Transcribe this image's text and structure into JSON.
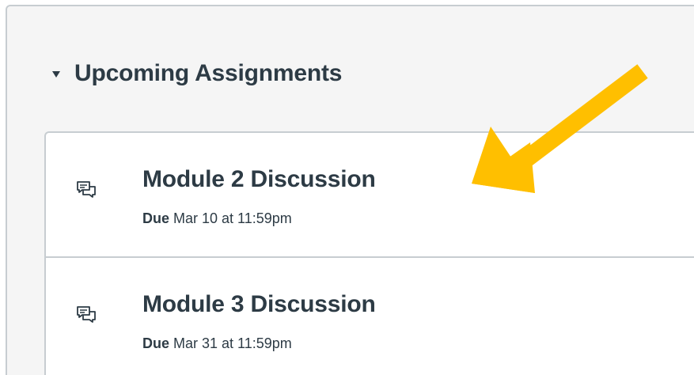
{
  "section": {
    "title": "Upcoming Assignments",
    "caret_icon": "caret-down-icon"
  },
  "assignments": [
    {
      "title": "Module 2 Discussion",
      "due_label": "Due",
      "due_date": "Mar 10 at 11:59pm",
      "icon": "discussion-icon"
    },
    {
      "title": "Module 3 Discussion",
      "due_label": "Due",
      "due_date": "Mar 31 at 11:59pm",
      "icon": "discussion-icon"
    }
  ],
  "annotation": {
    "arrow_color": "#ffbf00"
  },
  "colors": {
    "text": "#2d3b45",
    "panel_bg": "#f5f5f5",
    "border": "#c7cdd1"
  }
}
